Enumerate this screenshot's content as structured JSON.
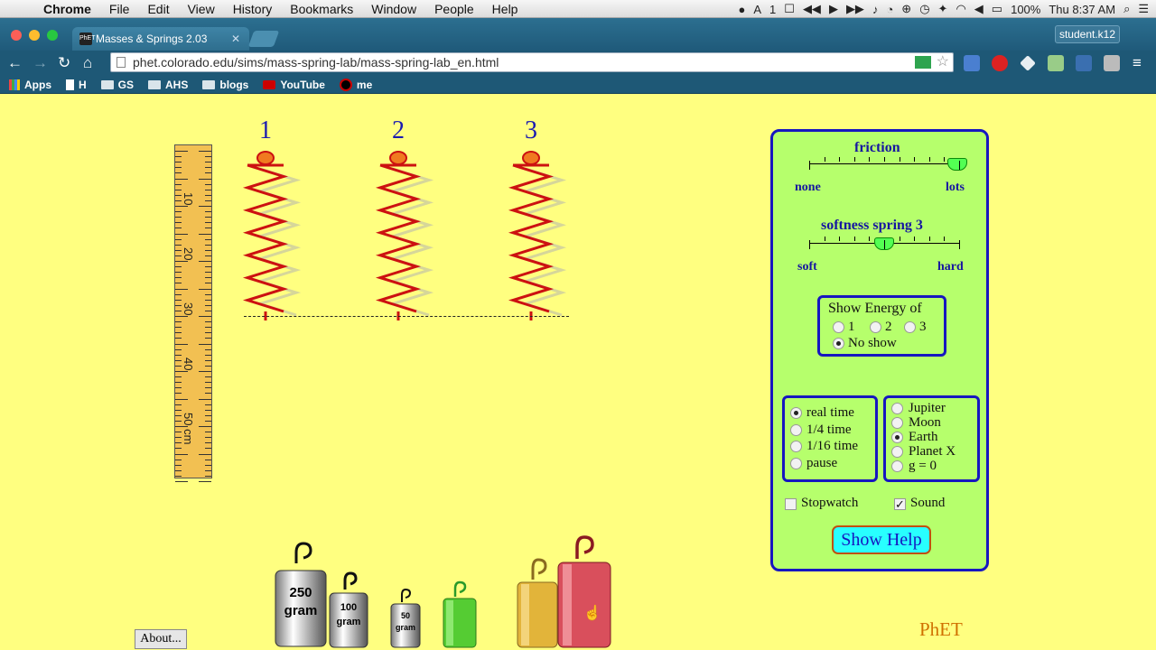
{
  "menubar": {
    "items": [
      "Chrome",
      "File",
      "Edit",
      "View",
      "History",
      "Bookmarks",
      "Window",
      "People",
      "Help"
    ],
    "right": {
      "tab_indicator": "1",
      "battery": "100%",
      "clock": "Thu 8:37 AM"
    }
  },
  "browser": {
    "tab_title": "Masses & Springs 2.03",
    "favicon_text": "PhET",
    "profile_button": "student.k12",
    "url": "phet.colorado.edu/sims/mass-spring-lab/mass-spring-lab_en.html",
    "bookmarks": [
      "Apps",
      "H",
      "GS",
      "AHS",
      "blogs",
      "YouTube",
      "me"
    ]
  },
  "sim": {
    "spring_labels": [
      "1",
      "2",
      "3"
    ],
    "ruler": {
      "labels": [
        "10",
        "20",
        "30",
        "40",
        "50 cm"
      ]
    },
    "masses": [
      {
        "label_top": "250",
        "label_bottom": "gram",
        "color": "#c8c8c8"
      },
      {
        "label_top": "100",
        "label_bottom": "gram",
        "color": "#c8c8c8"
      },
      {
        "label_top": "50",
        "label_bottom": "gram",
        "color": "#c8c8c8"
      },
      {
        "label_top": "",
        "label_bottom": "",
        "color": "#55cc33"
      },
      {
        "label_top": "",
        "label_bottom": "",
        "color": "#e2b43a"
      },
      {
        "label_top": "",
        "label_bottom": "",
        "color": "#d94f5c"
      }
    ],
    "about_button": "About...",
    "brand": "PhET"
  },
  "panel": {
    "friction": {
      "title": "friction",
      "min_label": "none",
      "max_label": "lots",
      "value": 0.99
    },
    "softness": {
      "title": "softness spring 3",
      "min_label": "soft",
      "max_label": "hard",
      "value": 0.5
    },
    "energy": {
      "title": "Show Energy of",
      "options": [
        "1",
        "2",
        "3",
        "No show"
      ],
      "selected": "No show"
    },
    "time": {
      "options": [
        "real time",
        "1/4 time",
        "1/16 time",
        "pause"
      ],
      "selected": "real time"
    },
    "gravity": {
      "options": [
        "Jupiter",
        "Moon",
        "Earth",
        "Planet X",
        "g = 0"
      ],
      "selected": "Earth"
    },
    "stopwatch": {
      "label": "Stopwatch",
      "checked": false
    },
    "sound": {
      "label": "Sound",
      "checked": true
    },
    "help_button": "Show Help"
  },
  "colors": {
    "sim_bg": "#ffff80",
    "panel_bg": "#b6ff6c",
    "panel_border": "#1616c0",
    "spring": "#cc1111"
  }
}
